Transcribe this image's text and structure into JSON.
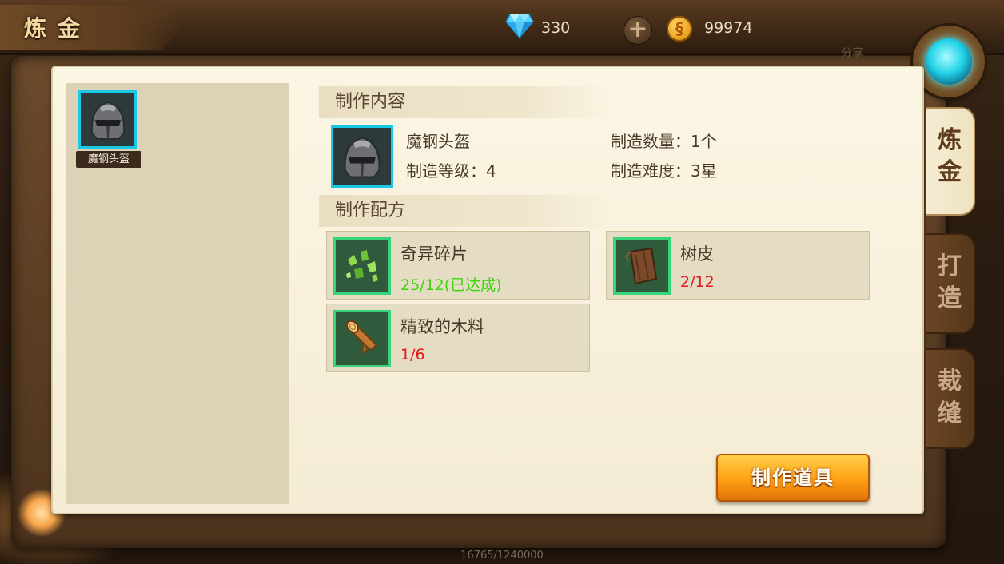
{
  "header": {
    "title": "炼金",
    "gems": "330",
    "coins": "99974",
    "share_label": "分享"
  },
  "left_panel": {
    "items": [
      {
        "label": "魔钢头盔",
        "icon": "helmet-icon"
      }
    ]
  },
  "content": {
    "section_title": "制作内容",
    "item_name": "魔钢头盔",
    "level": "制造等级：4",
    "quantity": "制造数量：1个",
    "difficulty": "制造难度：3星"
  },
  "recipe": {
    "section_title": "制作配方",
    "materials": [
      {
        "name": "奇异碎片",
        "qty": "25/12(已达成)",
        "status": "ok",
        "icon": "crystal-shards-icon"
      },
      {
        "name": "树皮",
        "qty": "2/12",
        "status": "insufficient",
        "icon": "bark-icon"
      },
      {
        "name": "精致的木料",
        "qty": "1/6",
        "status": "insufficient",
        "icon": "wood-log-icon"
      }
    ]
  },
  "craft_button": "制作道具",
  "side_tabs": [
    {
      "label": "炼金",
      "active": true
    },
    {
      "label": "打造",
      "active": false
    },
    {
      "label": "裁缝",
      "active": false
    }
  ],
  "footer": {
    "exp_text": "16765/1240000"
  },
  "colors": {
    "accent_cyan": "#19c9e6",
    "ok_green": "#3ed40c",
    "warn_red": "#e8141c",
    "button_orange": "#ff9f12"
  }
}
